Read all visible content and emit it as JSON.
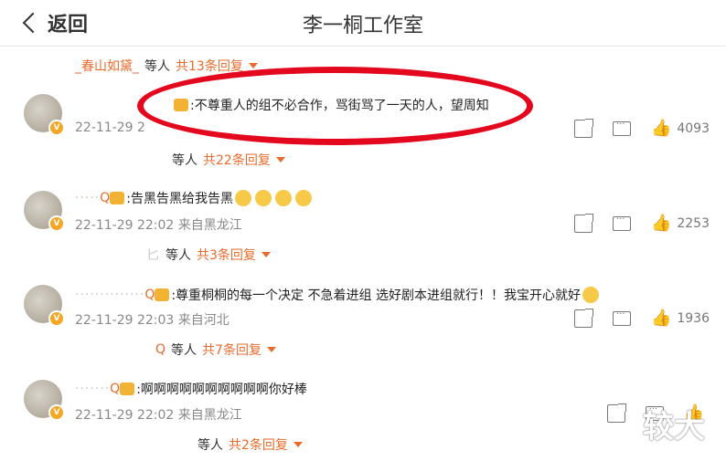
{
  "header": {
    "back_label": "返回",
    "title": "李一桐工作室"
  },
  "top_reply": {
    "name": "_春山如黛_",
    "deng": "等人",
    "count": "共13条回复"
  },
  "comments": [
    {
      "text": ":不尊重人的组不必合作，骂街骂了一天的人，望周知",
      "time": "22-11-29 2",
      "likes": "4093",
      "reply": {
        "deng": "等人",
        "count": "共22条回复"
      }
    },
    {
      "name": "Q",
      "text": ":告黑告黑给我告黑",
      "time": "22-11-29 22:02 来自黑龙江",
      "likes": "2253",
      "reply": {
        "name": "匕",
        "deng": "等人",
        "count": "共3条回复"
      }
    },
    {
      "name": "Q",
      "text": ":尊重桐桐的每一个决定  不急着进组 选好剧本进组就行！！我宝开心就好",
      "time": "22-11-29 22:03 来自河北",
      "likes": "1936",
      "reply": {
        "name": "Q",
        "deng": "等人",
        "count": "共7条回复"
      }
    },
    {
      "name": "Q",
      "text": ":啊啊啊啊啊啊啊啊啊啊你好棒",
      "time": "22-11-29 22:02 来自黑龙江",
      "likes": "",
      "reply": {
        "deng": "等人",
        "count": "共2条回复"
      }
    }
  ],
  "watermark": "较大",
  "icons": {
    "back": "chevron-left-icon",
    "share": "share-icon",
    "comment": "comment-icon",
    "like": "thumbs-up-icon"
  },
  "colors": {
    "accent": "#e86b2c",
    "annotation": "#e3081d"
  }
}
